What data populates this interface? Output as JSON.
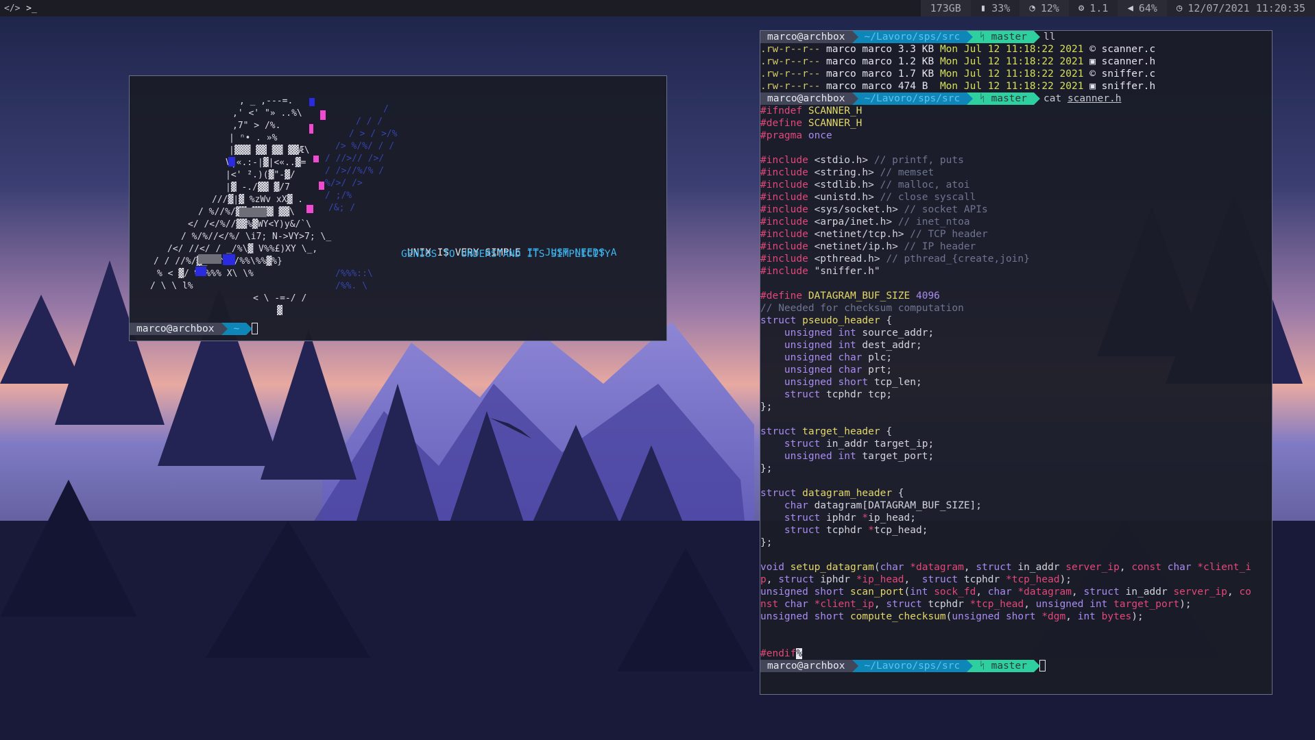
{
  "topbar": {
    "workspaces": [
      {
        "label": "</>",
        "icon": "code-icon"
      },
      {
        "label": ">_",
        "icon": "terminal-icon"
      }
    ],
    "status": [
      {
        "icon": "disk-icon",
        "value": "173GB"
      },
      {
        "icon": "memory-icon",
        "value": "33%"
      },
      {
        "icon": "cpu-gauge-icon",
        "value": "12%"
      },
      {
        "icon": "load-icon",
        "value": "1.1"
      },
      {
        "icon": "volume-icon",
        "value": "64%"
      },
      {
        "icon": "clock-icon",
        "value": "12/07/2021 11:20:35"
      }
    ]
  },
  "left_terminal": {
    "quote_line1_a": "UNIX IS VERY SIMPLE ",
    "quote_line1_b": "IT JUST NEEDS A",
    "quote_line2": "GENIUS TO UNDERSTAND ITS SIMPLICITY",
    "prompt_user": "marco@archbox",
    "prompt_dir": "~"
  },
  "right_terminal": {
    "prompt": {
      "user": "marco@archbox",
      "dir": "~/Lavoro/sps/src",
      "branch": "ᛋ master"
    },
    "cmd1": "ll",
    "files": [
      {
        "perm": ".rw-r--r--",
        "owner": "marco marco",
        "size": "3.3 KB",
        "date": "Mon Jul 12 11:18:22 2021",
        "icon": "©",
        "name": "scanner.c"
      },
      {
        "perm": ".rw-r--r--",
        "owner": "marco marco",
        "size": "1.2 KB",
        "date": "Mon Jul 12 11:18:22 2021",
        "icon": "▣",
        "name": "scanner.h"
      },
      {
        "perm": ".rw-r--r--",
        "owner": "marco marco",
        "size": "1.7 KB",
        "date": "Mon Jul 12 11:18:22 2021",
        "icon": "©",
        "name": "sniffer.c"
      },
      {
        "perm": ".rw-r--r--",
        "owner": "marco marco",
        "size": "474 B ",
        "date": "Mon Jul 12 11:18:22 2021",
        "icon": "▣",
        "name": "sniffer.h"
      }
    ],
    "cmd2": "cat",
    "cmd2_arg": "scanner.h",
    "code": {
      "ifndef": "#ifndef",
      "ifndef_val": "SCANNER_H",
      "define": "#define",
      "define_val": "SCANNER_H",
      "pragma": "#pragma",
      "pragma_val": "once",
      "includes": [
        {
          "hdr": "<stdio.h>",
          "comment": "// printf, puts"
        },
        {
          "hdr": "<string.h>",
          "comment": "// memset"
        },
        {
          "hdr": "<stdlib.h>",
          "comment": "// malloc, atoi"
        },
        {
          "hdr": "<unistd.h>",
          "comment": "// close syscall"
        },
        {
          "hdr": "<sys/socket.h>",
          "comment": "// socket APIs"
        },
        {
          "hdr": "<arpa/inet.h>",
          "comment": "// inet_ntoa"
        },
        {
          "hdr": "<netinet/tcp.h>",
          "comment": "// TCP header"
        },
        {
          "hdr": "<netinet/ip.h>",
          "comment": "// IP header"
        },
        {
          "hdr": "<pthread.h>",
          "comment": "// pthread_{create,join}"
        },
        {
          "hdr": "\"sniffer.h\"",
          "comment": ""
        }
      ],
      "include_kw": "#include",
      "buf_define": "DATAGRAM_BUF_SIZE",
      "buf_value": "4096",
      "checksum_comment": "// Needed for checksum computation",
      "endif": "#endif",
      "endif_marker": "%"
    }
  }
}
